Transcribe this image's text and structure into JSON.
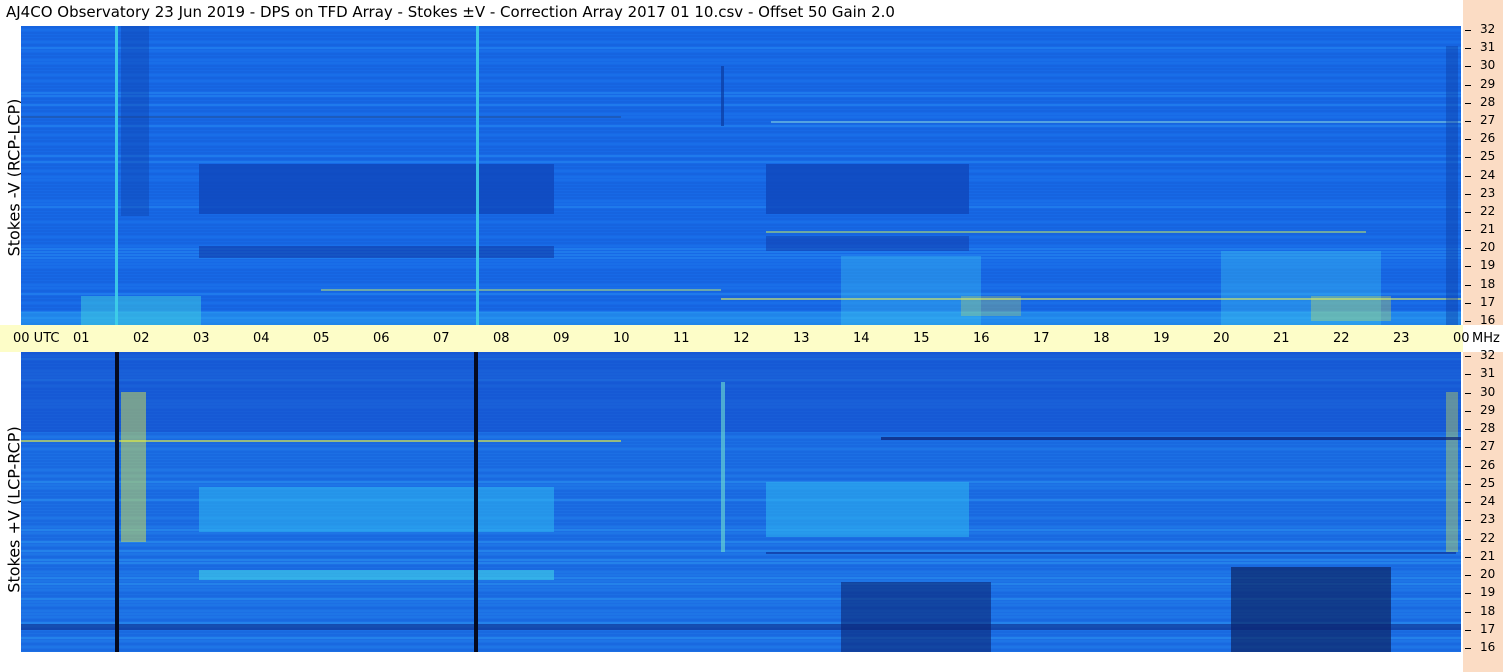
{
  "title": "AJ4CO Observatory  23 Jun 2019  -  DPS on TFD Array  -  Stokes ±V  -  Correction Array 2017 01 10.csv  -  Offset 50  Gain 2.0",
  "panels": {
    "top_label": "Stokes -V (RCP-LCP)",
    "bottom_label": "Stokes +V (LCP-RCP)"
  },
  "time_axis": {
    "start_label": "00  UTC",
    "hours": [
      "01",
      "02",
      "03",
      "04",
      "05",
      "06",
      "07",
      "08",
      "09",
      "10",
      "11",
      "12",
      "13",
      "14",
      "15",
      "16",
      "17",
      "18",
      "19",
      "20",
      "21",
      "22",
      "23",
      "00"
    ],
    "end_unit": "MHz"
  },
  "freq_axis": {
    "labels": [
      "32",
      "31",
      "30",
      "29",
      "28",
      "27",
      "26",
      "25",
      "24",
      "23",
      "22",
      "21",
      "20",
      "19",
      "18",
      "17",
      "16"
    ]
  },
  "colors": {
    "base_blue": "#1a6de0",
    "dark_blue": "#0d3fb8",
    "light_cyan": "#3fc8f0",
    "yellow": "#e8f040",
    "axis_band": "#fdfdc8",
    "right_strip": "#fbdcc4"
  },
  "chart_data": {
    "type": "heatmap",
    "title": "AJ4CO Observatory  23 Jun 2019  -  DPS on TFD Array  -  Stokes ±V  -  Correction Array 2017 01 10.csv  -  Offset 50  Gain 2.0",
    "xlabel": "UTC",
    "ylabel_top": "Stokes -V (RCP-LCP)",
    "ylabel_bottom": "Stokes +V (LCP-RCP)",
    "x_range_hours": [
      0,
      24
    ],
    "y_range_mhz": [
      16,
      32
    ],
    "y_unit": "MHz"
  }
}
